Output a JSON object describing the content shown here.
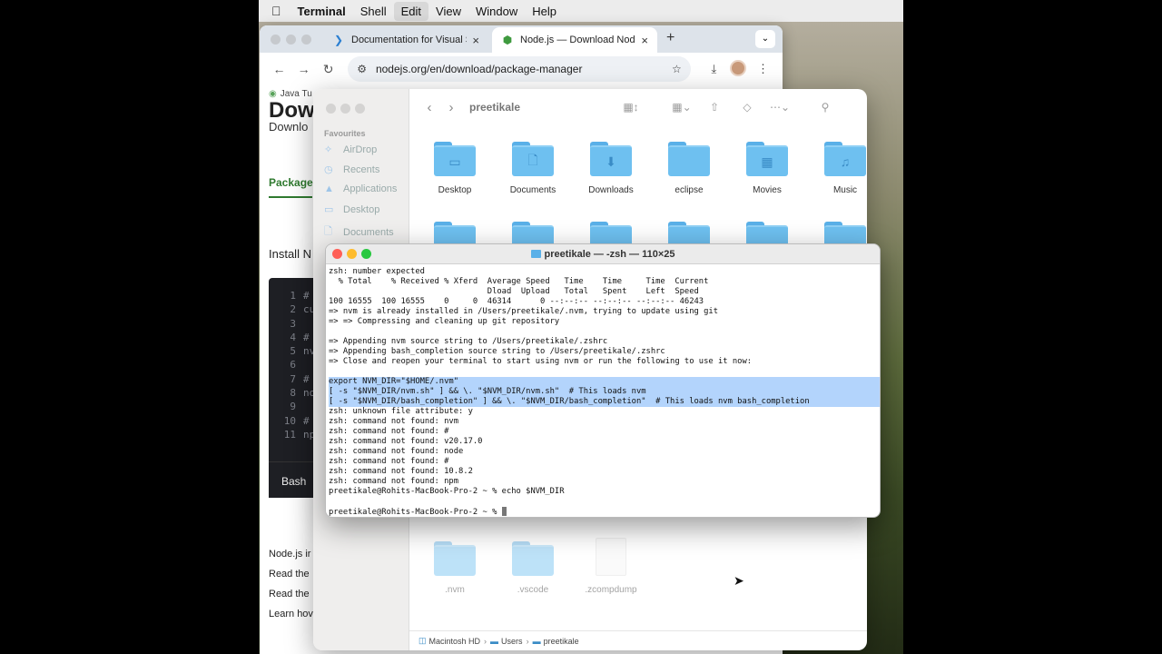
{
  "menubar": {
    "apple": "",
    "items": [
      "Terminal",
      "Shell",
      "Edit",
      "View",
      "Window",
      "Help"
    ]
  },
  "browser": {
    "tabs": [
      {
        "label": "Documentation for Visual Stu",
        "icon": "vscode-icon"
      },
      {
        "label": "Node.js — Download Node.js",
        "icon": "nodejs-icon"
      }
    ],
    "url": "nodejs.org/en/download/package-manager",
    "bookmark": "Java Tu",
    "page": {
      "heading": "Dow",
      "subtitle": "Downlo",
      "tab_label": "Package",
      "install_text": "Install N",
      "code_lines": [
        {
          "n": "1",
          "t": "#"
        },
        {
          "n": "2",
          "t": "cu"
        },
        {
          "n": "3",
          "t": ""
        },
        {
          "n": "4",
          "t": "#"
        },
        {
          "n": "5",
          "t": "nv"
        },
        {
          "n": "6",
          "t": ""
        },
        {
          "n": "7",
          "t": "#"
        },
        {
          "n": "8",
          "t": "no"
        },
        {
          "n": "9",
          "t": ""
        },
        {
          "n": "10",
          "t": "#"
        },
        {
          "n": "11",
          "t": "np"
        }
      ],
      "code_tab": "Bash",
      "links": [
        "Node.js ir",
        "Read the",
        "Read the",
        "Learn hov"
      ]
    }
  },
  "finder": {
    "title": "preetikale",
    "sidebar_header": "Favourites",
    "sidebar": [
      "AirDrop",
      "Recents",
      "Applications",
      "Desktop",
      "Documents"
    ],
    "folders_row1": [
      {
        "name": "Desktop",
        "glyph": "▭"
      },
      {
        "name": "Documents",
        "glyph": "🗋"
      },
      {
        "name": "Downloads",
        "glyph": "⬇"
      },
      {
        "name": "eclipse",
        "glyph": ""
      },
      {
        "name": "Movies",
        "glyph": "▦"
      },
      {
        "name": "Music",
        "glyph": "♫"
      }
    ],
    "folders_bottom": [
      {
        "name": ".nvm"
      },
      {
        "name": ".vscode"
      }
    ],
    "file_bottom": ".zcompdump",
    "path": [
      "Macintosh HD",
      "Users",
      "preetikale"
    ]
  },
  "terminal": {
    "title": "preetikale — -zsh — 110×25",
    "lines": [
      {
        "t": "zsh: number expected",
        "sel": false
      },
      {
        "t": "  % Total    % Received % Xferd  Average Speed   Time    Time     Time  Current",
        "sel": false
      },
      {
        "t": "                                 Dload  Upload   Total   Spent    Left  Speed",
        "sel": false
      },
      {
        "t": "100 16555  100 16555    0     0  46314      0 --:--:-- --:--:-- --:--:-- 46243",
        "sel": false
      },
      {
        "t": "=> nvm is already installed in /Users/preetikale/.nvm, trying to update using git",
        "sel": false
      },
      {
        "t": "=> => Compressing and cleaning up git repository",
        "sel": false
      },
      {
        "t": "",
        "sel": false
      },
      {
        "t": "=> Appending nvm source string to /Users/preetikale/.zshrc",
        "sel": false
      },
      {
        "t": "=> Appending bash_completion source string to /Users/preetikale/.zshrc",
        "sel": false
      },
      {
        "t": "=> Close and reopen your terminal to start using nvm or run the following to use it now:",
        "sel": false
      },
      {
        "t": "",
        "sel": false
      },
      {
        "t": "export NVM_DIR=\"$HOME/.nvm\"",
        "sel": true
      },
      {
        "t": "[ -s \"$NVM_DIR/nvm.sh\" ] && \\. \"$NVM_DIR/nvm.sh\"  # This loads nvm",
        "sel": true
      },
      {
        "t": "[ -s \"$NVM_DIR/bash_completion\" ] && \\. \"$NVM_DIR/bash_completion\"  # This loads nvm bash_completion",
        "sel": true
      },
      {
        "t": "zsh: unknown file attribute: y",
        "sel": false
      },
      {
        "t": "zsh: command not found: nvm",
        "sel": false
      },
      {
        "t": "zsh: command not found: #",
        "sel": false
      },
      {
        "t": "zsh: command not found: v20.17.0",
        "sel": false
      },
      {
        "t": "zsh: command not found: node",
        "sel": false
      },
      {
        "t": "zsh: command not found: #",
        "sel": false
      },
      {
        "t": "zsh: command not found: 10.8.2",
        "sel": false
      },
      {
        "t": "zsh: command not found: npm",
        "sel": false
      },
      {
        "t": "preetikale@Rohits-MacBook-Pro-2 ~ % echo $NVM_DIR",
        "sel": false
      },
      {
        "t": "",
        "sel": false
      },
      {
        "t": "preetikale@Rohits-MacBook-Pro-2 ~ % ",
        "sel": false,
        "cursor": true
      }
    ]
  }
}
